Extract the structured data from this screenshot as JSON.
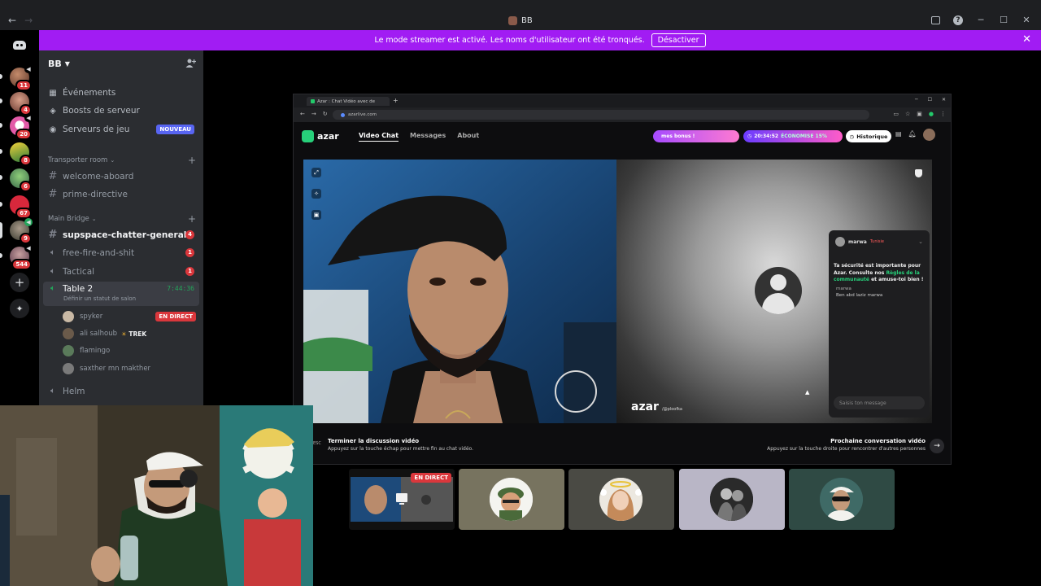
{
  "titlebar": {
    "server_name": "BB",
    "nav_back": "←",
    "nav_forward": "→",
    "minimize": "─",
    "maximize": "☐",
    "close": "✕"
  },
  "banner": {
    "text": "Le mode streamer est activé. Les noms d'utilisateur ont été tronqués.",
    "button": "Désactiver",
    "close": "✕"
  },
  "rail": {
    "servers": [
      {
        "badge": "11",
        "color": "#7a4b3a"
      },
      {
        "badge": "4",
        "color": "#9a6b55"
      },
      {
        "badge": "20",
        "color": "#d65ba5"
      },
      {
        "badge": "8",
        "color": "#e6c23a"
      },
      {
        "badge": "6",
        "color": "#5a9a5a"
      },
      {
        "badge": "67",
        "color": "#d63a4a"
      },
      {
        "badge": "9",
        "color": "#6a6a5a"
      },
      {
        "badge": "544",
        "color": "#8a5a6a"
      }
    ],
    "add_label": "+",
    "explore_label": "✦"
  },
  "sidebar": {
    "server_name": "BB",
    "menu": [
      {
        "icon": "calendar-icon",
        "glyph": "▦",
        "label": "Événements"
      },
      {
        "icon": "boost-icon",
        "glyph": "◈",
        "label": "Boosts de serveur"
      },
      {
        "icon": "gamepad-icon",
        "glyph": "◉",
        "label": "Serveurs de jeu",
        "badge": "NOUVEAU"
      }
    ],
    "categories": [
      {
        "label": "Transporter room"
      },
      {
        "label": "Main Bridge"
      }
    ],
    "channels": [
      {
        "type": "text",
        "label": "welcome-aboard"
      },
      {
        "type": "text",
        "label": "prime-directive"
      },
      {
        "type": "text",
        "label": "supspace-chatter-general",
        "count": "4",
        "unread": true
      },
      {
        "type": "voice",
        "label": "free-fire-and-shit",
        "count": "1"
      },
      {
        "type": "voice",
        "label": "Tactical",
        "count": "1"
      },
      {
        "type": "voice",
        "label": "Table 2",
        "timer": "7:44:36",
        "status": "Définir un statut de salon"
      },
      {
        "type": "voice",
        "label": "Helm"
      }
    ],
    "voice_users": [
      {
        "name": "spyker",
        "live": "EN DIRECT",
        "color": "#c9b9a5"
      },
      {
        "name": "ali salhoub",
        "trek_icon": "☀",
        "trek": "TREK",
        "color": "#6a5a4a"
      },
      {
        "name": "flamingo",
        "color": "#5a7a5a"
      },
      {
        "name": "saxther mn makther",
        "color": "#7a7a7a"
      }
    ]
  },
  "browser": {
    "tab_title": "Azar : Chat Vidéo avec de",
    "new_tab": "+",
    "url": "azarlive.com",
    "nav": {
      "logo": "azar",
      "links": [
        "Video Chat",
        "Messages",
        "About"
      ]
    },
    "bonus": "mes bonus !",
    "promo_time": "20:34:52",
    "promo_text": "ÉCONOMISE 15%",
    "history": "Historique",
    "watermark": "azar",
    "watermark_sub": "/@ploofka",
    "chat": {
      "user": "marwa",
      "country": "Tunisie",
      "notice_1": "Ta sécurité est importante pour Azar. Consulte nos ",
      "notice_link": "Règles de la communauté",
      "notice_2": " et amuse-toi bien !",
      "msg_user": "marwa",
      "msg_text": "Ben abd laziz marwa",
      "input_placeholder": "Saisis ton message"
    },
    "bottom_left_title": "Terminer la discussion vidéo",
    "bottom_left_sub": "Appuyez sur la touche échap pour mettre fin au chat vidéo.",
    "esc_label": "ESC",
    "bottom_right_title": "Prochaine conversation vidéo",
    "bottom_right_sub": "Appuyez sur la touche droite pour rencontrer d'autres personnes"
  },
  "tiles": [
    {
      "live": "EN DIRECT",
      "bg": "#1a1a1a"
    },
    {
      "bg": "#77735f"
    },
    {
      "bg": "#4a4a44"
    },
    {
      "bg": "#b9b6c6"
    },
    {
      "bg": "#2f4a44"
    }
  ]
}
